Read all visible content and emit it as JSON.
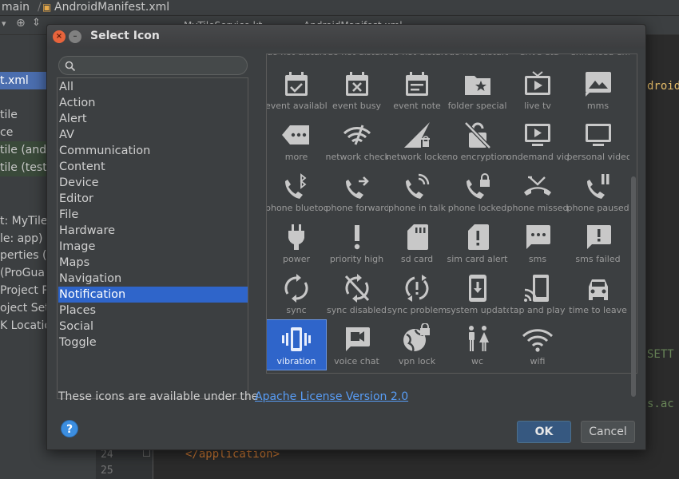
{
  "ide": {
    "breadcrumb": [
      "main",
      "AndroidManifest.xml"
    ],
    "tabs": [
      "MyTileService.kt",
      "AndroidManifest.xml"
    ],
    "left_rows": [
      {
        "text": "t.xml",
        "state": "sel"
      },
      {
        "text": "tile",
        "state": ""
      },
      {
        "text": "ce",
        "state": ""
      },
      {
        "text": "tile (and",
        "state": "grn"
      },
      {
        "text": "tile (test",
        "state": "grn"
      },
      {
        "text": "t: MyTile",
        "state": ""
      },
      {
        "text": "le: app)",
        "state": ""
      },
      {
        "text": "perties (",
        "state": ""
      },
      {
        "text": "(ProGua",
        "state": ""
      },
      {
        "text": "Project P",
        "state": ""
      },
      {
        "text": "oject Sett",
        "state": ""
      },
      {
        "text": "K Locatio",
        "state": ""
      }
    ],
    "line_numbers": [
      "24",
      "25"
    ],
    "code_line": "</application>",
    "right_snippets": [
      "droid",
      "SETT",
      "s.ac"
    ]
  },
  "dialog": {
    "title": "Select Icon",
    "search": {
      "placeholder": ""
    },
    "categories": [
      "All",
      "Action",
      "Alert",
      "AV",
      "Communication",
      "Content",
      "Device",
      "Editor",
      "File",
      "Hardware",
      "Image",
      "Maps",
      "Navigation",
      "Notification",
      "Places",
      "Social",
      "Toggle"
    ],
    "selected_category": "Notification",
    "cut_labels": [
      "do not disturb",
      "do not disturb",
      "do not disturb",
      "do not disturb",
      "drive eta",
      "enhanced encr"
    ],
    "icons": [
      {
        "label": "event available",
        "icon": "event-available-icon"
      },
      {
        "label": "event busy",
        "icon": "event-busy-icon"
      },
      {
        "label": "event note",
        "icon": "event-note-icon"
      },
      {
        "label": "folder special",
        "icon": "folder-special-icon"
      },
      {
        "label": "live tv",
        "icon": "live-tv-icon"
      },
      {
        "label": "mms",
        "icon": "mms-icon"
      },
      {
        "label": "more",
        "icon": "more-icon"
      },
      {
        "label": "network check",
        "icon": "network-check-icon"
      },
      {
        "label": "network locked",
        "icon": "network-locked-icon"
      },
      {
        "label": "no encryption",
        "icon": "no-encryption-icon"
      },
      {
        "label": "ondemand video",
        "icon": "ondemand-video-icon"
      },
      {
        "label": "personal video",
        "icon": "personal-video-icon"
      },
      {
        "label": "phone bluetooth",
        "icon": "phone-bluetooth-icon"
      },
      {
        "label": "phone forward",
        "icon": "phone-forward-icon"
      },
      {
        "label": "phone in talk",
        "icon": "phone-in-talk-icon"
      },
      {
        "label": "phone locked",
        "icon": "phone-locked-icon"
      },
      {
        "label": "phone missed",
        "icon": "phone-missed-icon"
      },
      {
        "label": "phone paused",
        "icon": "phone-paused-icon"
      },
      {
        "label": "power",
        "icon": "power-icon"
      },
      {
        "label": "priority high",
        "icon": "priority-high-icon"
      },
      {
        "label": "sd card",
        "icon": "sd-card-icon"
      },
      {
        "label": "sim card alert",
        "icon": "sim-card-alert-icon"
      },
      {
        "label": "sms",
        "icon": "sms-icon"
      },
      {
        "label": "sms failed",
        "icon": "sms-failed-icon"
      },
      {
        "label": "sync",
        "icon": "sync-icon"
      },
      {
        "label": "sync disabled",
        "icon": "sync-disabled-icon"
      },
      {
        "label": "sync problem",
        "icon": "sync-problem-icon"
      },
      {
        "label": "system update",
        "icon": "system-update-icon"
      },
      {
        "label": "tap and play",
        "icon": "tap-and-play-icon"
      },
      {
        "label": "time to leave",
        "icon": "time-to-leave-icon"
      },
      {
        "label": "vibration",
        "icon": "vibration-icon"
      },
      {
        "label": "voice chat",
        "icon": "voice-chat-icon"
      },
      {
        "label": "vpn lock",
        "icon": "vpn-lock-icon"
      },
      {
        "label": "wc",
        "icon": "wc-icon"
      },
      {
        "label": "wifi",
        "icon": "wifi-icon"
      }
    ],
    "selected_icon": "vibration",
    "license_text": "These icons are available under the",
    "license_link": "Apache License Version 2.0",
    "help_label": "?",
    "ok_label": "OK",
    "cancel_label": "Cancel"
  },
  "colors": {
    "accent": "#2f65ca",
    "icon": "#c8c8c8",
    "link": "#589df6"
  }
}
